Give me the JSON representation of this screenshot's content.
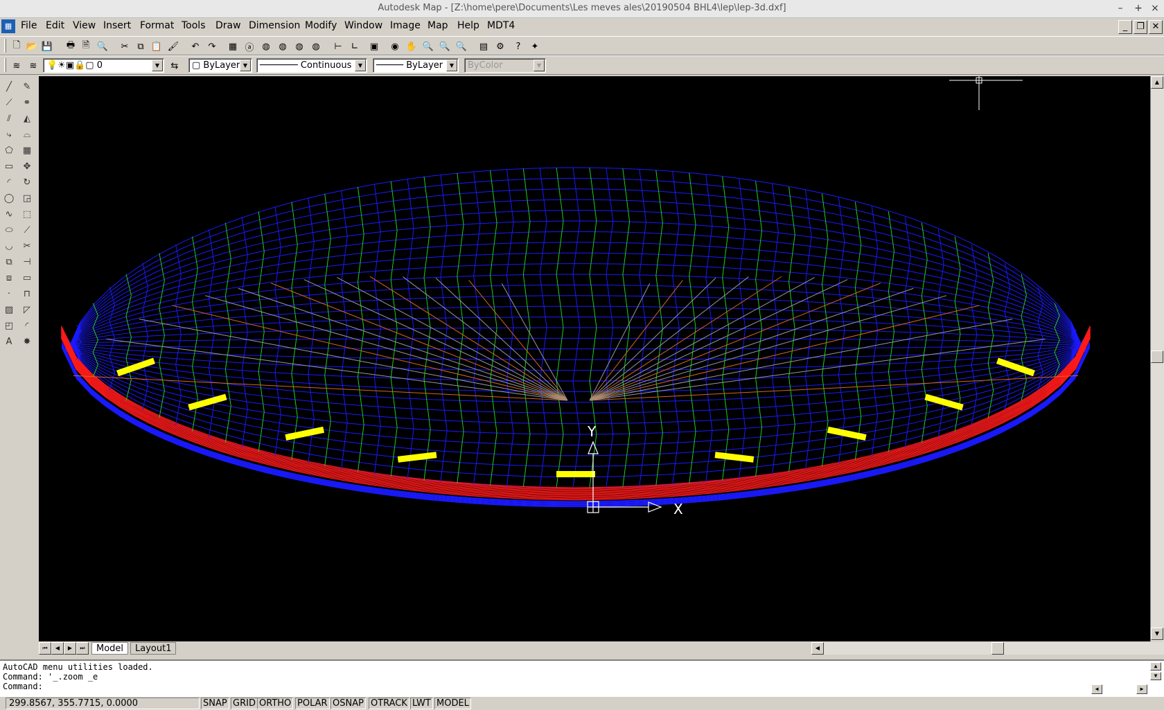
{
  "window": {
    "title": "Autodesk Map - [Z:\\home\\pere\\Documents\\Les meves ales\\20190504 BHL4\\lep\\lep-3d.dxf]"
  },
  "menu": [
    "File",
    "Edit",
    "View",
    "Insert",
    "Format",
    "Tools",
    "Draw",
    "Dimension",
    "Modify",
    "Window",
    "Image",
    "Map",
    "Help",
    "MDT4"
  ],
  "properties": {
    "layer": "0",
    "color": "ByLayer",
    "linetype": "Continuous",
    "lineweight": "ByLayer",
    "plotstyle": "ByColor"
  },
  "ucs": {
    "x_label": "X",
    "y_label": "Y"
  },
  "tabs": [
    "Model",
    "Layout1"
  ],
  "command": {
    "lines": [
      "AutoCAD menu utilities loaded.",
      "Command: '_.zoom _e",
      "Command:"
    ]
  },
  "status": {
    "coords": "299.8567, 355.7715, 0.0000",
    "toggles": [
      "SNAP",
      "GRID",
      "ORTHO",
      "POLAR",
      "OSNAP",
      "OTRACK",
      "LWT",
      "MODEL"
    ]
  },
  "colors": {
    "viewport_bg": "#000000",
    "mesh_blue": "#1a1aff",
    "mesh_green": "#22cc22",
    "mesh_red": "#ff1a1a",
    "mark_yellow": "#ffff00"
  }
}
